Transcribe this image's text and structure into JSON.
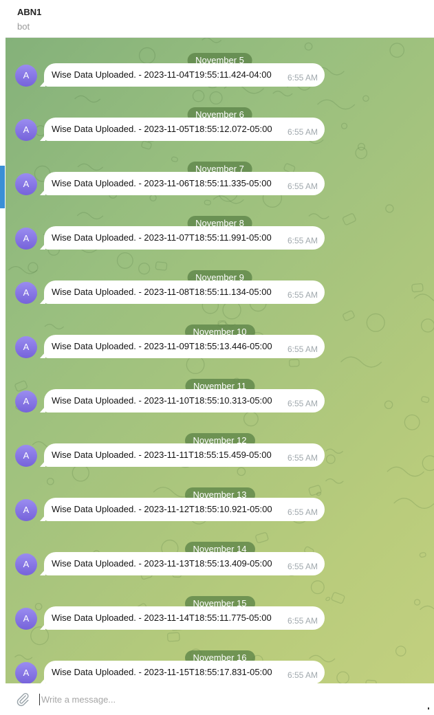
{
  "chat": {
    "title": "ABN1",
    "subtitle": "bot"
  },
  "avatar_letter": "A",
  "messages": [
    {
      "date": "November 5",
      "text": "Wise Data Uploaded. - 2023-11-04T19:55:11.424-04:00",
      "time": "6:55 AM"
    },
    {
      "date": "November 6",
      "text": "Wise Data Uploaded. - 2023-11-05T18:55:12.072-05:00",
      "time": "6:55 AM"
    },
    {
      "date": "November 7",
      "text": "Wise Data Uploaded. - 2023-11-06T18:55:11.335-05:00",
      "time": "6:55 AM"
    },
    {
      "date": "November 8",
      "text": "Wise Data Uploaded. - 2023-11-07T18:55:11.991-05:00",
      "time": "6:55 AM"
    },
    {
      "date": "November 9",
      "text": "Wise Data Uploaded. - 2023-11-08T18:55:11.134-05:00",
      "time": "6:55 AM"
    },
    {
      "date": "November 10",
      "text": "Wise Data Uploaded. - 2023-11-09T18:55:13.446-05:00",
      "time": "6:55 AM"
    },
    {
      "date": "November 11",
      "text": "Wise Data Uploaded. - 2023-11-10T18:55:10.313-05:00",
      "time": "6:55 AM"
    },
    {
      "date": "November 12",
      "text": "Wise Data Uploaded. - 2023-11-11T18:55:15.459-05:00",
      "time": "6:55 AM"
    },
    {
      "date": "November 13",
      "text": "Wise Data Uploaded. - 2023-11-12T18:55:10.921-05:00",
      "time": "6:55 AM"
    },
    {
      "date": "November 14",
      "text": "Wise Data Uploaded. - 2023-11-13T18:55:13.409-05:00",
      "time": "6:55 AM"
    },
    {
      "date": "November 15",
      "text": "Wise Data Uploaded. - 2023-11-14T18:55:11.775-05:00",
      "time": "6:55 AM"
    },
    {
      "date": "November 16",
      "text": "Wise Data Uploaded. - 2023-11-15T18:55:17.831-05:00",
      "time": "6:55 AM"
    }
  ],
  "composer": {
    "placeholder": "Write a message...",
    "attach_icon": "paperclip-icon"
  },
  "colors": {
    "accent": "#3a8fd6",
    "avatar": "#8575e6",
    "date_pill": "#5c8448",
    "chat_bg": "#9fc27e"
  }
}
